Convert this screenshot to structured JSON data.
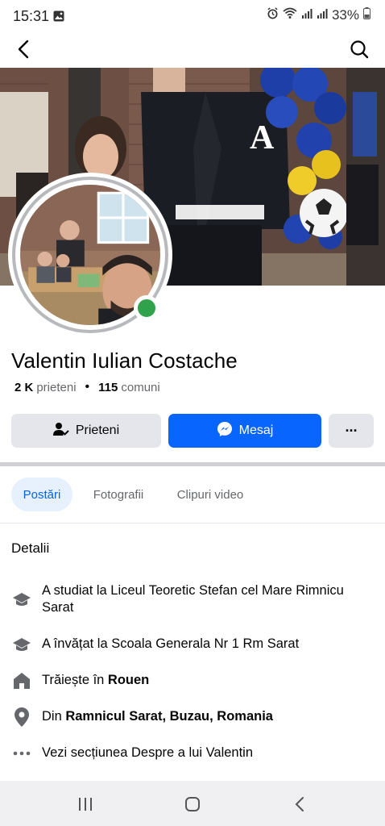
{
  "status_bar": {
    "time": "15:31",
    "battery": "33%",
    "icons": [
      "image-icon",
      "alarm-icon",
      "wifi-icon",
      "signal-icon",
      "signal-icon",
      "battery-icon"
    ]
  },
  "appbar": {
    "icons": [
      "back-arrow-icon",
      "search-icon"
    ]
  },
  "profile": {
    "name": "Valentin Iulian Costache",
    "friends_count": "2 K",
    "friends_label": "prieteni",
    "mutual_count": "115",
    "mutual_label": "comuni",
    "online": true
  },
  "actions": {
    "friends_label": "Prieteni",
    "message_label": "Mesaj",
    "more_label": "···"
  },
  "tabs": [
    {
      "label": "Postări",
      "active": true
    },
    {
      "label": "Fotografii",
      "active": false
    },
    {
      "label": "Clipuri video",
      "active": false
    }
  ],
  "details": {
    "title": "Detalii",
    "items": [
      {
        "icon": "graduation-cap-icon",
        "prefix": "A studiat la Liceul Teoretic Stefan cel Mare Rimnicu Sarat",
        "bold": ""
      },
      {
        "icon": "graduation-cap-icon",
        "prefix": "A învățat la Scoala Generala Nr 1 Rm Sarat",
        "bold": ""
      },
      {
        "icon": "home-icon",
        "prefix": "Trăiește în ",
        "bold": "Rouen"
      },
      {
        "icon": "location-pin-icon",
        "prefix": "Din ",
        "bold": "Ramnicul Sarat, Buzau, Romania"
      },
      {
        "icon": "more-dots-icon",
        "prefix": "Vezi secțiunea Despre a lui Valentin",
        "bold": ""
      }
    ]
  },
  "navbar": {
    "icons": [
      "recent-apps-icon",
      "home-button-icon",
      "back-nav-icon"
    ]
  },
  "colors": {
    "accent": "#0866ff",
    "online": "#31a24c",
    "secondary_button": "#e4e6eb",
    "active_tab_bg": "#e7f0fd",
    "active_tab_text": "#0a63d8"
  }
}
